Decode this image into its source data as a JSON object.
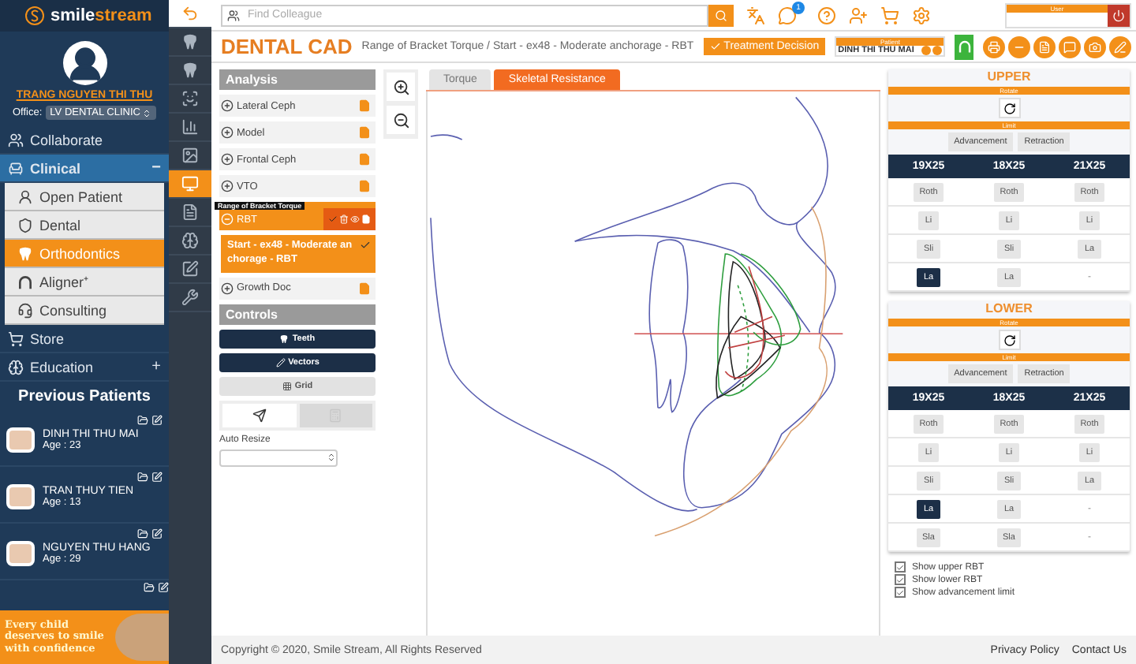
{
  "brand": {
    "name": "smile",
    "name_accent": "stream"
  },
  "profile": {
    "name": "TRANG NGUYEN THI THU",
    "office_label": "Office:",
    "office": "LV DENTAL CLINIC"
  },
  "nav": [
    {
      "label": "Collaborate",
      "kind": "section",
      "selected": false
    },
    {
      "label": "Clinical",
      "kind": "group",
      "selected": false,
      "toggle": "−"
    },
    {
      "label": "Open Patient",
      "kind": "sub",
      "selected": false
    },
    {
      "label": "Dental",
      "kind": "sub",
      "selected": false
    },
    {
      "label": "Orthodontics",
      "kind": "sub",
      "selected": true
    },
    {
      "label": "Aligner⁺",
      "kind": "sub",
      "selected": false
    },
    {
      "label": "Consulting",
      "kind": "sub",
      "selected": false
    },
    {
      "label": "Store",
      "kind": "section",
      "selected": false
    },
    {
      "label": "Education",
      "kind": "section",
      "selected": false,
      "toggle": "+"
    }
  ],
  "previous_patients": {
    "title": "Previous Patients",
    "items": [
      {
        "name": "DINH THI THU MAI",
        "age": "Age : 23"
      },
      {
        "name": "TRAN THUY TIEN",
        "age": "Age : 13"
      },
      {
        "name": "NGUYEN THU HANG",
        "age": "Age : 29"
      }
    ]
  },
  "banner": {
    "text": "Every child deserves to smile with confidence"
  },
  "tools": [
    {
      "selected": false
    },
    {
      "selected": false
    },
    {
      "selected": false
    },
    {
      "selected": false
    },
    {
      "selected": false
    },
    {
      "selected": true
    },
    {
      "selected": false
    },
    {
      "selected": false
    },
    {
      "selected": false
    },
    {
      "selected": false
    }
  ],
  "search": {
    "placeholder": "Find Colleague"
  },
  "notifications": {
    "badge": "1"
  },
  "user_box": {
    "label": "User"
  },
  "header": {
    "title": "DENTAL CAD",
    "breadcrumb": [
      "Range of Bracket Torque",
      "Start - ex48 - Moderate anchorage - RBT"
    ],
    "separator": "/",
    "treatment_button": "Treatment Decision"
  },
  "patient_box": {
    "label": "Patient",
    "name": "DINH THI THU MAI"
  },
  "analysis": {
    "title": "Analysis",
    "tooltip": "Range of Bracket Torque",
    "items": [
      {
        "label": "Lateral Ceph",
        "expanded": false
      },
      {
        "label": "Model",
        "expanded": false
      },
      {
        "label": "Frontal Ceph",
        "expanded": false
      },
      {
        "label": "VTO",
        "expanded": false
      },
      {
        "label": "RBT",
        "expanded": true,
        "children": [
          {
            "label": "Start - ex48 - Moderate anchorage - RBT"
          }
        ]
      },
      {
        "label": "Growth Doc",
        "expanded": false
      }
    ]
  },
  "controls": {
    "title": "Controls",
    "buttons": [
      {
        "label": "Teeth",
        "active": true
      },
      {
        "label": "Vectors",
        "active": true
      },
      {
        "label": "Grid",
        "active": false
      }
    ],
    "modes": [
      {
        "selected": true
      },
      {
        "selected": false
      }
    ],
    "auto_resize": {
      "label": "Auto Resize"
    }
  },
  "tabs": [
    {
      "label": "Torque",
      "selected": false
    },
    {
      "label": "Skeletal Resistance",
      "selected": true
    }
  ],
  "arches": [
    {
      "title": "UPPER",
      "rotate_label": "Rotate",
      "limit_label": "Limit",
      "buttons": [
        "Advancement",
        "Retraction"
      ],
      "columns": [
        "19X25",
        "18X25",
        "21X25"
      ],
      "rows": [
        [
          {
            "label": "Roth",
            "kind": "option",
            "selected": false
          },
          {
            "label": "Roth",
            "kind": "option",
            "selected": false
          },
          {
            "label": "Roth",
            "kind": "option",
            "selected": false
          }
        ],
        [
          {
            "label": "Li",
            "kind": "option",
            "selected": false
          },
          {
            "label": "Li",
            "kind": "option",
            "selected": false
          },
          {
            "label": "Li",
            "kind": "option",
            "selected": false
          }
        ],
        [
          {
            "label": "Sli",
            "kind": "option",
            "selected": false
          },
          {
            "label": "Sli",
            "kind": "option",
            "selected": false
          },
          {
            "label": "La",
            "kind": "option",
            "selected": false
          }
        ],
        [
          {
            "label": "La",
            "kind": "option",
            "selected": true
          },
          {
            "label": "La",
            "kind": "option",
            "selected": false
          },
          {
            "label": "-",
            "kind": "none"
          }
        ]
      ]
    },
    {
      "title": "LOWER",
      "rotate_label": "Rotate",
      "limit_label": "Limit",
      "buttons": [
        "Advancement",
        "Retraction"
      ],
      "columns": [
        "19X25",
        "18X25",
        "21X25"
      ],
      "rows": [
        [
          {
            "label": "Roth",
            "kind": "option",
            "selected": false
          },
          {
            "label": "Roth",
            "kind": "option",
            "selected": false
          },
          {
            "label": "Roth",
            "kind": "option",
            "selected": false
          }
        ],
        [
          {
            "label": "Li",
            "kind": "option",
            "selected": false
          },
          {
            "label": "Li",
            "kind": "option",
            "selected": false
          },
          {
            "label": "Li",
            "kind": "option",
            "selected": false
          }
        ],
        [
          {
            "label": "Sli",
            "kind": "option",
            "selected": false
          },
          {
            "label": "Sli",
            "kind": "option",
            "selected": false
          },
          {
            "label": "La",
            "kind": "option",
            "selected": false
          }
        ],
        [
          {
            "label": "La",
            "kind": "option",
            "selected": true
          },
          {
            "label": "La",
            "kind": "option",
            "selected": false
          },
          {
            "label": "-",
            "kind": "none"
          }
        ],
        [
          {
            "label": "Sla",
            "kind": "option",
            "selected": false
          },
          {
            "label": "Sla",
            "kind": "option",
            "selected": false
          },
          {
            "label": "-",
            "kind": "none"
          }
        ]
      ]
    }
  ],
  "checks": [
    {
      "label": "Show upper RBT",
      "checked": true
    },
    {
      "label": "Show lower RBT",
      "checked": true
    },
    {
      "label": "Show advancement limit",
      "checked": true
    }
  ],
  "footer": {
    "copyright": "Copyright © 2020, Smile Stream, All Rights Reserved",
    "links": [
      "Privacy Policy",
      "Contact Us"
    ]
  }
}
